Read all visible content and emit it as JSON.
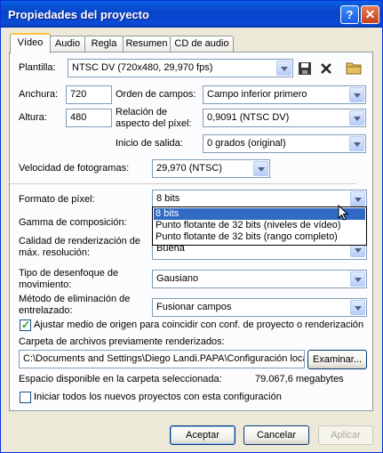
{
  "window": {
    "title": "Propiedades del proyecto",
    "help_glyph": "?",
    "close_glyph": "✕"
  },
  "tabs": [
    {
      "label": "Vídeo"
    },
    {
      "label": "Audio"
    },
    {
      "label": "Regla"
    },
    {
      "label": "Resumen"
    },
    {
      "label": "CD de audio"
    }
  ],
  "form": {
    "template": {
      "label": "Plantilla:",
      "value": "NTSC DV (720x480, 29,970 fps)"
    },
    "width": {
      "label": "Anchura:",
      "value": "720"
    },
    "height": {
      "label": "Altura:",
      "value": "480"
    },
    "field_order": {
      "label": "Orden de campos:",
      "value": "Campo inferior primero"
    },
    "pixel_aspect": {
      "label": "Relación de aspecto del píxel:",
      "value": "0,9091 (NTSC DV)"
    },
    "output_start": {
      "label": "Inicio de salida:",
      "value": "0 grados (original)"
    },
    "frame_rate": {
      "label": "Velocidad de fotogramas:",
      "value": "29,970 (NTSC)"
    },
    "pixel_format": {
      "label": "Formato de píxel:",
      "value": "8 bits",
      "options": [
        "8 bits",
        "Punto flotante de 32 bits (niveles de vídeo)",
        "Punto flotante de 32 bits (rango completo)"
      ]
    },
    "compositing_gamma": {
      "label": "Gamma de composición:"
    },
    "render_quality": {
      "label": "Calidad de renderización de máx. resolución:",
      "value": "Buena"
    },
    "motion_blur": {
      "label": "Tipo de desenfoque de movimiento:",
      "value": "Gausiano"
    },
    "deinterlace": {
      "label": "Método de eliminación de entrelazado:",
      "value": "Fusionar campos"
    },
    "adjust_source": {
      "label": "Ajustar medio de origen para coincidir con conf. de proyecto o renderización",
      "checked": true
    },
    "prerender_folder": {
      "label": "Carpeta de archivos previamente renderizados:",
      "value": "C:\\Documents and Settings\\Diego Landi.PAPA\\Configuración loca",
      "browse": "Examinar..."
    },
    "free_space": {
      "label": "Espacio disponible en la carpeta seleccionada:",
      "value": "79.067,6 megabytes"
    },
    "start_all": {
      "label": "Iniciar todos los nuevos proyectos con esta configuración",
      "checked": false
    }
  },
  "buttons": {
    "ok": "Aceptar",
    "cancel": "Cancelar",
    "apply": "Aplicar"
  }
}
